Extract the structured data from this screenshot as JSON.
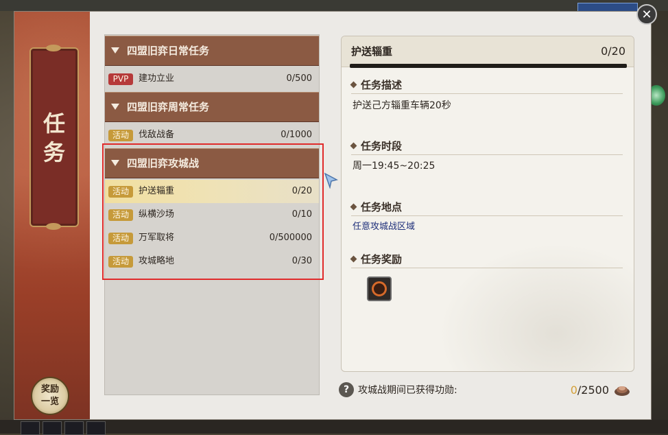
{
  "window": {
    "title": "任务",
    "reward_button": "奖励一览",
    "close_label": "✕"
  },
  "categories": [
    {
      "title": "四盟旧弈日常任务",
      "tasks": [
        {
          "tag": "PVP",
          "name": "建功立业",
          "progress": "0/500"
        }
      ]
    },
    {
      "title": "四盟旧弈周常任务",
      "tasks": [
        {
          "tag": "活动",
          "name": "伐敌战备",
          "progress": "0/1000"
        }
      ]
    },
    {
      "title": "四盟旧弈攻城战",
      "tasks": [
        {
          "tag": "活动",
          "name": "护送辎重",
          "progress": "0/20",
          "selected": true
        },
        {
          "tag": "活动",
          "name": "纵横沙场",
          "progress": "0/10"
        },
        {
          "tag": "活动",
          "name": "万军取将",
          "progress": "0/500000"
        },
        {
          "tag": "活动",
          "name": "攻城略地",
          "progress": "0/30"
        }
      ]
    }
  ],
  "detail": {
    "title": "护送辎重",
    "count": "0/20",
    "sections": {
      "desc_title": "任务描述",
      "desc_text": "护送己方辎重车辆20秒",
      "time_title": "任务时段",
      "time_text": "周一19:45~20:25",
      "place_title": "任务地点",
      "place_text": "任意攻城战区域",
      "reward_title": "任务奖励"
    }
  },
  "footer": {
    "help_icon": "?",
    "label": "攻城战期间已获得功勋:",
    "current": "0",
    "total": "/2500"
  },
  "icons": {
    "reward_item": "medal-icon",
    "merit": "merit-icon"
  }
}
